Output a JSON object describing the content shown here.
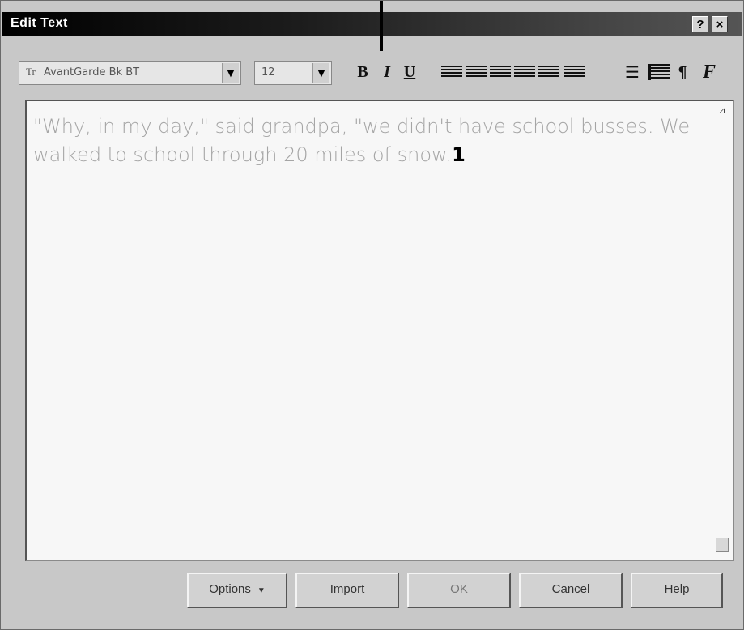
{
  "window": {
    "title": "Edit Text",
    "help_button": "?",
    "close_button": "×"
  },
  "toolbar": {
    "font_icon": "Tr",
    "font_name": "AvantGarde Bk BT",
    "font_size": "12",
    "bold": "B",
    "italic": "I",
    "underline": "U",
    "alignment_icons": [
      "align-none-icon",
      "align-left-icon",
      "align-center-icon",
      "align-right-icon",
      "align-full-icon",
      "align-force-icon"
    ],
    "bullets_icon": "bullets-icon",
    "columns_icon": "columns-icon",
    "paragraph": "¶",
    "font_style": "F"
  },
  "editor": {
    "text": "\"Why, in my day,\" said grandpa, \"we didn't have school busses. We walked to school through 20 miles of snow.",
    "caret": "1",
    "text_color": "#a5a5a5"
  },
  "buttons": {
    "options": "Options",
    "import": "Import",
    "ok": "OK",
    "cancel": "Cancel",
    "help": "Help"
  }
}
